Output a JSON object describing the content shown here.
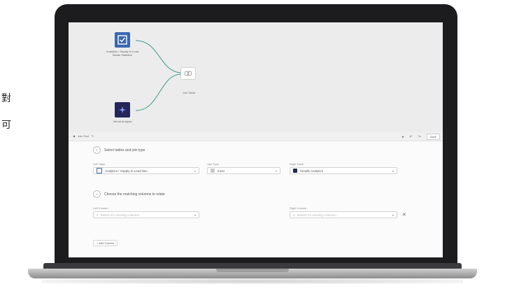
{
  "side_text": [
    "對",
    "可"
  ],
  "canvas": {
    "node1_label": "Analytics / Supply to Lead Waste Statistics",
    "node2_label": "Virtual Analysis",
    "join_label": "Join Table"
  },
  "toolbar": {
    "title": "Join Tool",
    "save_label": "Save"
  },
  "step1": {
    "number": "1",
    "text": "Select tables and join type",
    "left_table_label": "Left Table",
    "left_table_value": "Analytics / Supply to Lead Wa...",
    "join_type_label": "Join Type",
    "join_type_value": "Inner",
    "right_table_label": "Right Table",
    "right_table_value": "Sendle Analytics"
  },
  "step2": {
    "number": "2",
    "text": "Choose the matching columns to relate",
    "left_column_label": "Left Column",
    "left_column_placeholder": "Search for existing columns...",
    "right_column_label": "Right Column",
    "right_column_placeholder": "Search for existing columns...",
    "add_label": "+ Add Column"
  },
  "colors": {
    "node1_bg": "#3b67b0",
    "node2_bg": "#24265a",
    "wire": "#3a9a8a"
  }
}
